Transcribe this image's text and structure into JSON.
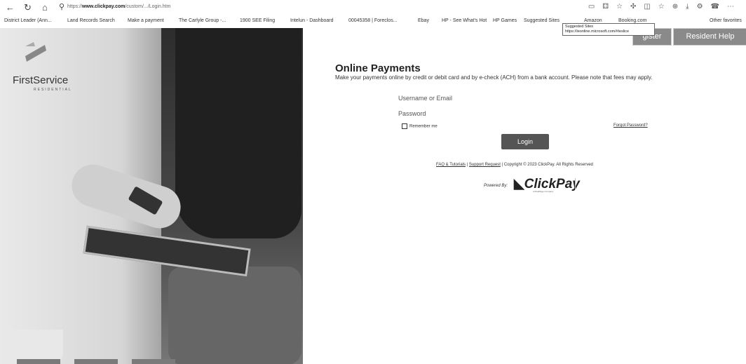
{
  "browser": {
    "url_prefix": "https://",
    "url_domain": "www.clickpay.com",
    "url_path": "/custom/.../Login.htm",
    "favorites": [
      "District Leader (Ann...",
      "Land Records Search",
      "Make a payment",
      "The Carlyle Group -...",
      "1900 SEE Filing",
      "Intelun - Dashboard",
      "00045358 | Foreclos...",
      "Ebay",
      "HP - See What's Hot",
      "HP Games",
      "Suggested Sites",
      "Amazon",
      "Booking.com"
    ],
    "other_favorites": "Other favorites",
    "tooltip_title": "Suggested Sites",
    "tooltip_url": "https://ieonline.microsoft.com/#ieslice"
  },
  "brand": {
    "name": "FirstService",
    "sub": "RESIDENTIAL"
  },
  "header_buttons": {
    "register": "gister",
    "help": "Resident Help Center"
  },
  "login_form": {
    "title": "Online Payments",
    "subtitle": "Make your payments online by credit or debit card and by e-check (ACH) from a bank account. Please note that fees may apply.",
    "username_placeholder": "Username or Email",
    "password_placeholder": "Password",
    "remember": "Remember me",
    "forgot": "Forgot Password?",
    "login_button": "Login"
  },
  "footer": {
    "faq": "FAQ & Tutorials",
    "sep": " | ",
    "support": "Support Request",
    "copyright": " | Copyright © 2023 ClickPay. All Rights Reserved",
    "powered_by": "Powered By:",
    "clickpay": "ClickPay",
    "clickpay_sub": "a RealPage Company"
  }
}
